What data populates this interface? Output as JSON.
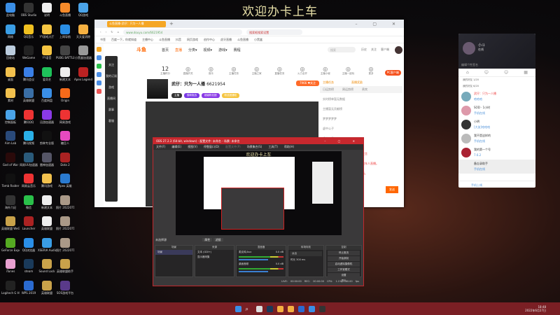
{
  "banner": "欢迎办卡上车",
  "desktop_icons": [
    {
      "label": "此电脑",
      "color": "#3a8ee6"
    },
    {
      "label": "OBS Studio",
      "color": "#333"
    },
    {
      "label": "说明",
      "color": "#eee"
    },
    {
      "label": "斗鱼直播",
      "color": "#f58a2a"
    },
    {
      "label": "QQ游戏",
      "color": "#4aa3e8"
    },
    {
      "label": "网络",
      "color": "#3a9ee6"
    },
    {
      "label": "QQ音乐",
      "color": "#f0c020"
    },
    {
      "label": "YY游戏大厅",
      "color": "#f5c542"
    },
    {
      "label": "上网导航",
      "color": "#2a8ee6"
    },
    {
      "label": "天天爱消除",
      "color": "#f5b041"
    },
    {
      "label": "回收站",
      "color": "#bcd"
    },
    {
      "label": "WeGame",
      "color": "#222"
    },
    {
      "label": "YY语音",
      "color": "#f5c542"
    },
    {
      "label": "PUBG BATTLEGR...",
      "color": "#444"
    },
    {
      "label": "小黑盒加速器",
      "color": "#999"
    },
    {
      "label": "桌面",
      "color": "#f2c14e"
    },
    {
      "label": "腾讯会议",
      "color": "#3a7fe6"
    },
    {
      "label": "爱奇艺",
      "color": "#1ec25a"
    },
    {
      "label": "新建文本",
      "color": "#eee"
    },
    {
      "label": "Apex Legends",
      "color": "#b22"
    },
    {
      "label": "素材",
      "color": "#f2c14e"
    },
    {
      "label": "英雄联盟",
      "color": "#3a6ea5"
    },
    {
      "label": "百度网盘",
      "color": "#3a8ee6"
    },
    {
      "label": "Origin",
      "color": "#f56a1a"
    },
    {
      "label": "",
      "color": ""
    },
    {
      "label": "控制面板",
      "color": "#4aa3e8"
    },
    {
      "label": "腾讯QQ",
      "color": "#e33"
    },
    {
      "label": "迅游加速器",
      "color": "#8a3ae6"
    },
    {
      "label": "网易游戏",
      "color": "#e33"
    },
    {
      "label": "",
      "color": ""
    },
    {
      "label": "Aim Lab",
      "color": "#2a4a7a"
    },
    {
      "label": "腾讯视频",
      "color": "#2ab0e8"
    },
    {
      "label": "剪映专业版",
      "color": "#111"
    },
    {
      "label": "糖豆人",
      "color": "#e64ac0"
    },
    {
      "label": "",
      "color": ""
    },
    {
      "label": "God of War",
      "color": "#2a0a0a"
    },
    {
      "label": "网易UU加速器",
      "color": "#2a5a7a"
    },
    {
      "label": "雷神加速器",
      "color": "#556"
    },
    {
      "label": "Dota 2",
      "color": "#a22"
    },
    {
      "label": "",
      "color": ""
    },
    {
      "label": "Tomb Raider",
      "color": "#111"
    },
    {
      "label": "网易云音乐",
      "color": "#e33"
    },
    {
      "label": "腾讯游戏",
      "color": "#f2c14e"
    },
    {
      "label": "Apex 英雄",
      "color": "#2a7ad0"
    },
    {
      "label": "",
      "color": ""
    },
    {
      "label": "海外六纪",
      "color": "#333"
    },
    {
      "label": "微信",
      "color": "#2ac04a"
    },
    {
      "label": "新建文本",
      "color": "#eee"
    },
    {
      "label": "照片 20220710",
      "color": "#a98"
    },
    {
      "label": "",
      "color": ""
    },
    {
      "label": "英雄联盟 WeGame版",
      "color": "#c9a24a"
    },
    {
      "label": "Launcher",
      "color": "#a22"
    },
    {
      "label": "英雄联盟",
      "color": "#eee"
    },
    {
      "label": "照片 20220710",
      "color": "#a98"
    },
    {
      "label": "",
      "color": ""
    },
    {
      "label": "GeForce Experience",
      "color": "#5a2"
    },
    {
      "label": "QQ浏览器",
      "color": "#2a8ee6"
    },
    {
      "label": "XSERIA Audio",
      "color": "#3a9ee6"
    },
    {
      "label": "照片 20220717",
      "color": "#a98"
    },
    {
      "label": "",
      "color": ""
    },
    {
      "label": "iTunes",
      "color": "#e8a0d0"
    },
    {
      "label": "steam",
      "color": "#1a3a5a"
    },
    {
      "label": "Sound Lock",
      "color": "#c9a24a"
    },
    {
      "label": "英雄联盟助手",
      "color": "#c9a24a"
    },
    {
      "label": "",
      "color": ""
    },
    {
      "label": "Logitech G HUB",
      "color": "#222"
    },
    {
      "label": "WPS 2019",
      "color": "#2a6ad0"
    },
    {
      "label": "英雄联盟",
      "color": "#c9a24a"
    },
    {
      "label": "SOS游戏平台",
      "color": "#5a3a8a"
    },
    {
      "label": "",
      "color": ""
    }
  ],
  "browser": {
    "tab": "斗鱼直播-武仔：只为一人播",
    "url": "www.douyu.com/6621954",
    "search": "搜索框搜索设置",
    "bookmarks": [
      "书签",
      "百度一下，你就知道",
      "主播中心",
      "斗鱼直播",
      "抖音",
      "网页游戏",
      "创作中心",
      "虎牙直播",
      "斗鱼直播",
      "小黑盒"
    ],
    "sidebar_colors": [
      "#f5a623",
      "#4a8ee6",
      "#2ac04a",
      "#4a8ee6",
      "#4a8ee6",
      "#e55"
    ],
    "douyu": {
      "logo": "斗鱼",
      "nav": [
        "首页",
        "直播",
        "分类▾",
        "视频▾",
        "游戏▾",
        "赛程"
      ],
      "search_placeholder": "搜索",
      "header_icons": [
        "历史",
        "关注",
        "客户端"
      ],
      "left_nav": [
        "关注",
        "我的订阅",
        "游戏",
        "直播间",
        "赛事",
        "客服"
      ],
      "tools": [
        {
          "big": "12",
          "label": "主播积分"
        },
        {
          "label": "直播开关"
        },
        {
          "label": "音乐"
        },
        {
          "label": "主播任务"
        },
        {
          "label": "主播之家"
        },
        {
          "label": "直播任务"
        },
        {
          "label": "火力全开"
        },
        {
          "label": "主播小秘"
        },
        {
          "label": "主播一起玩"
        },
        {
          "label": "更多"
        }
      ],
      "pc_client": "PC客户端",
      "streamer": {
        "name": "武仔：只为一人播",
        "room_id": "6621954",
        "followers": "7966",
        "follow": "关注",
        "tags": [
          "主播",
          "猫咪挑战",
          "超级粉丝团",
          "粉丝团通知"
        ]
      },
      "right_panel": {
        "tabs": [
          "主播任务",
          "直播奖励"
        ],
        "sub_tabs": [
          "日运势榜",
          "周运势榜",
          "贵宾"
        ],
        "rows": [
          "实时榜单暂无数据",
          "主播暂无贡献榜",
          "梦梦梦梦梦",
          "虚中公子",
          "虚中公子",
          "系统提示：【弹幕公告】请文明发言",
          "欢迎来到本直播间，斗鱼严禁未成年人直播。",
          "请勿相信私下交易，以防受骗上当。"
        ],
        "red_rows": [
          5,
          6,
          7
        ],
        "send": "发送"
      }
    }
  },
  "obs": {
    "title": "OBS 27.2.3 (64-bit, windows) - 配置文件: 未命名 - 场景: 未命名",
    "menu": [
      "文件(F)",
      "编辑(E)",
      "视图(V)",
      "停靠窗口(D)",
      "配置文件(P)",
      "场景集合(S)",
      "工具(T)",
      "帮助(H)"
    ],
    "no_source": "未选择源",
    "scene_buttons": [
      "属性",
      "滤镜"
    ],
    "docks": {
      "scenes": {
        "title": "场景",
        "items": [
          "场景"
        ]
      },
      "sources": {
        "title": "来源",
        "items": [
          "文本 (GDI+)",
          "显示器采集"
        ]
      },
      "mixer": {
        "title": "混音器",
        "items": [
          "麦克风/Aux",
          "桌面音频"
        ],
        "level": "0.0 dB"
      },
      "transitions": {
        "title": "转场特效",
        "type": "淡出",
        "duration_label": "时长",
        "duration": "300 ms"
      },
      "controls": {
        "title": "控制",
        "items": [
          "停止推流",
          "开始录制",
          "启动虚拟摄像机",
          "工作室模式",
          "设置",
          "退出"
        ]
      }
    },
    "status": [
      "LIVE: 00:00:00",
      "REC: 00:00:00",
      "CPU: 1.1%, 60.00 fps"
    ]
  },
  "qq": {
    "name": "小斗",
    "status": "在线",
    "signature": "编辑个性签名",
    "groups": [
      "我的好友 1/20",
      "我的好友 6/20"
    ],
    "contacts": [
      {
        "name": "武仔：只为一人播",
        "sub": "哈哈哈",
        "color": "#7ab"
      },
      {
        "name": "SOD · 1小时",
        "sub": "手机在线",
        "color": "#d9a"
      },
      {
        "name": "小明",
        "sub": "[大笑]哈哈哈",
        "color": "#333"
      },
      {
        "name": "我不是这样的",
        "sub": "手机在线",
        "color": "#bbb"
      },
      {
        "name": "我的第一个号",
        "sub": "7.6.2",
        "color": "#a23"
      },
      {
        "name": "备忘录助手",
        "sub": "手机在线",
        "color": "#eee"
      }
    ],
    "bottom": "手机上线"
  },
  "taskbar": {
    "time": "18:48",
    "date": "2022年6月27日"
  }
}
